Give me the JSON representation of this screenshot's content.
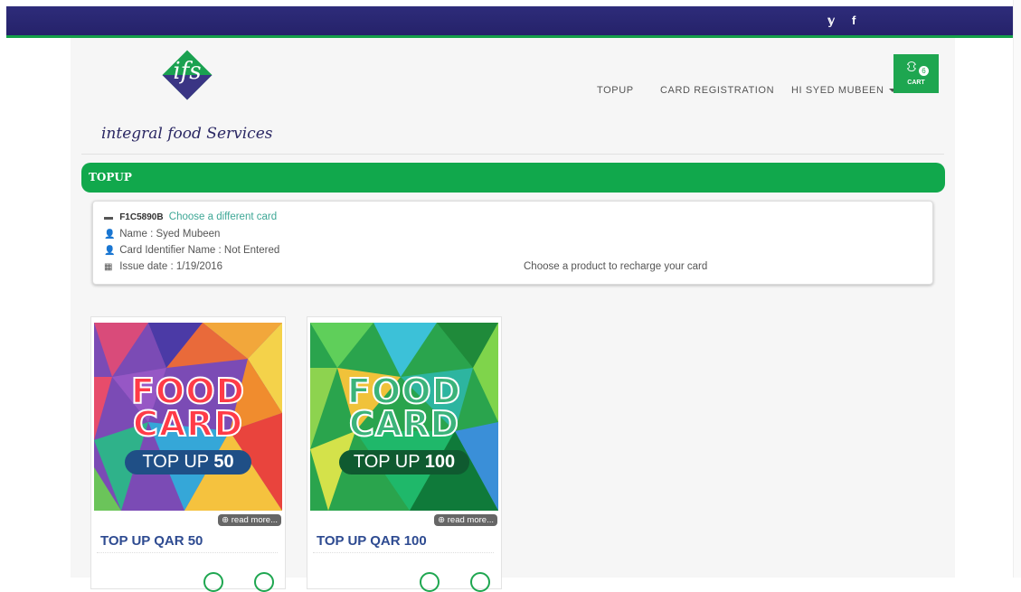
{
  "social": {
    "twitter": "🐦",
    "facebook": "f"
  },
  "logo": {
    "mark": "ifs",
    "brand_name": "integral food Services"
  },
  "nav": {
    "topup": "TOPUP",
    "card_registration": "CARD REGISTRATION",
    "user_menu": "HI SYED MUBEEN"
  },
  "cart": {
    "count": "6",
    "label": "CART"
  },
  "section": {
    "title": "TOPUP"
  },
  "card_info": {
    "card_id": "F1C5890B",
    "choose_link": "Choose a different card",
    "name": "Name : Syed Mubeen",
    "identifier": "Card Identifier Name : Not Entered",
    "issue_date": "Issue date : 1/19/2016",
    "hint": "Choose a product to recharge your card"
  },
  "products": [
    {
      "image_line1": "FOOD",
      "image_line2": "CARD",
      "image_pill_prefix": "TOP UP ",
      "image_pill_value": "50",
      "read_more": "⊕ read more...",
      "title": "TOP UP QAR 50",
      "pill_color": "#1f4f86"
    },
    {
      "image_line1": "FOOD",
      "image_line2": "CARD",
      "image_pill_prefix": "TOP UP ",
      "image_pill_value": "100",
      "read_more": "⊕ read more...",
      "title": "TOP UP QAR 100",
      "pill_color": "#0f5a30"
    }
  ],
  "colors": {
    "header": "#2e2c7a",
    "accent_green": "#11a84c",
    "link": "#3ea796",
    "product_title": "#2e4b91"
  }
}
